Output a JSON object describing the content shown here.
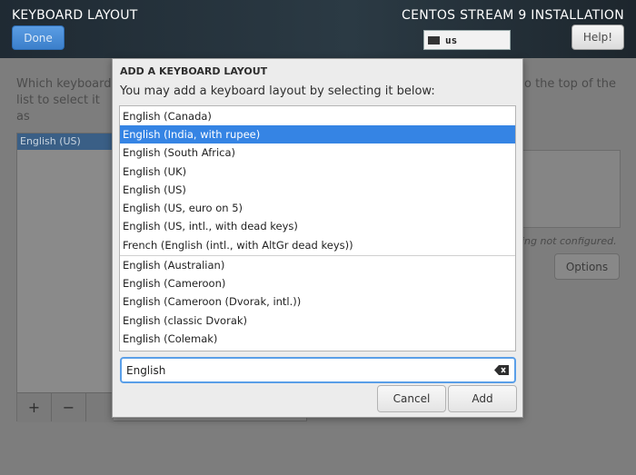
{
  "header": {
    "title": "KEYBOARD LAYOUT",
    "install_title": "CENTOS STREAM 9 INSTALLATION",
    "done_label": "Done",
    "help_label": "Help!",
    "keyboard_indicator": "us"
  },
  "background": {
    "description_left": "Which keyboard list to select it as",
    "description_right": "o the top of the",
    "selected_layout": "English (US)",
    "add_symbol": "+",
    "remove_symbol": "−",
    "not_configured": "hing not configured.",
    "options_label": "Options"
  },
  "dialog": {
    "title": "ADD A KEYBOARD LAYOUT",
    "subtitle": "You may add a keyboard layout by selecting it below:",
    "primary_layouts": [
      "English (Canada)",
      "English (India, with rupee)",
      "English (South Africa)",
      "English (UK)",
      "English (US)",
      "English (US, euro on 5)",
      "English (US, intl., with dead keys)",
      "French (English (intl., with AltGr dead keys))"
    ],
    "other_layouts": [
      "English (Australian)",
      "English (Cameroon)",
      "English (Cameroon (Dvorak, intl.))",
      "English (classic Dvorak)",
      "English (Colemak)"
    ],
    "selected_index": 1,
    "search_value": "English",
    "cancel_label": "Cancel",
    "add_label": "Add"
  },
  "colors": {
    "selection": "#3584e4",
    "focus_border": "#5a9fe8",
    "header_bg": "#243038"
  }
}
